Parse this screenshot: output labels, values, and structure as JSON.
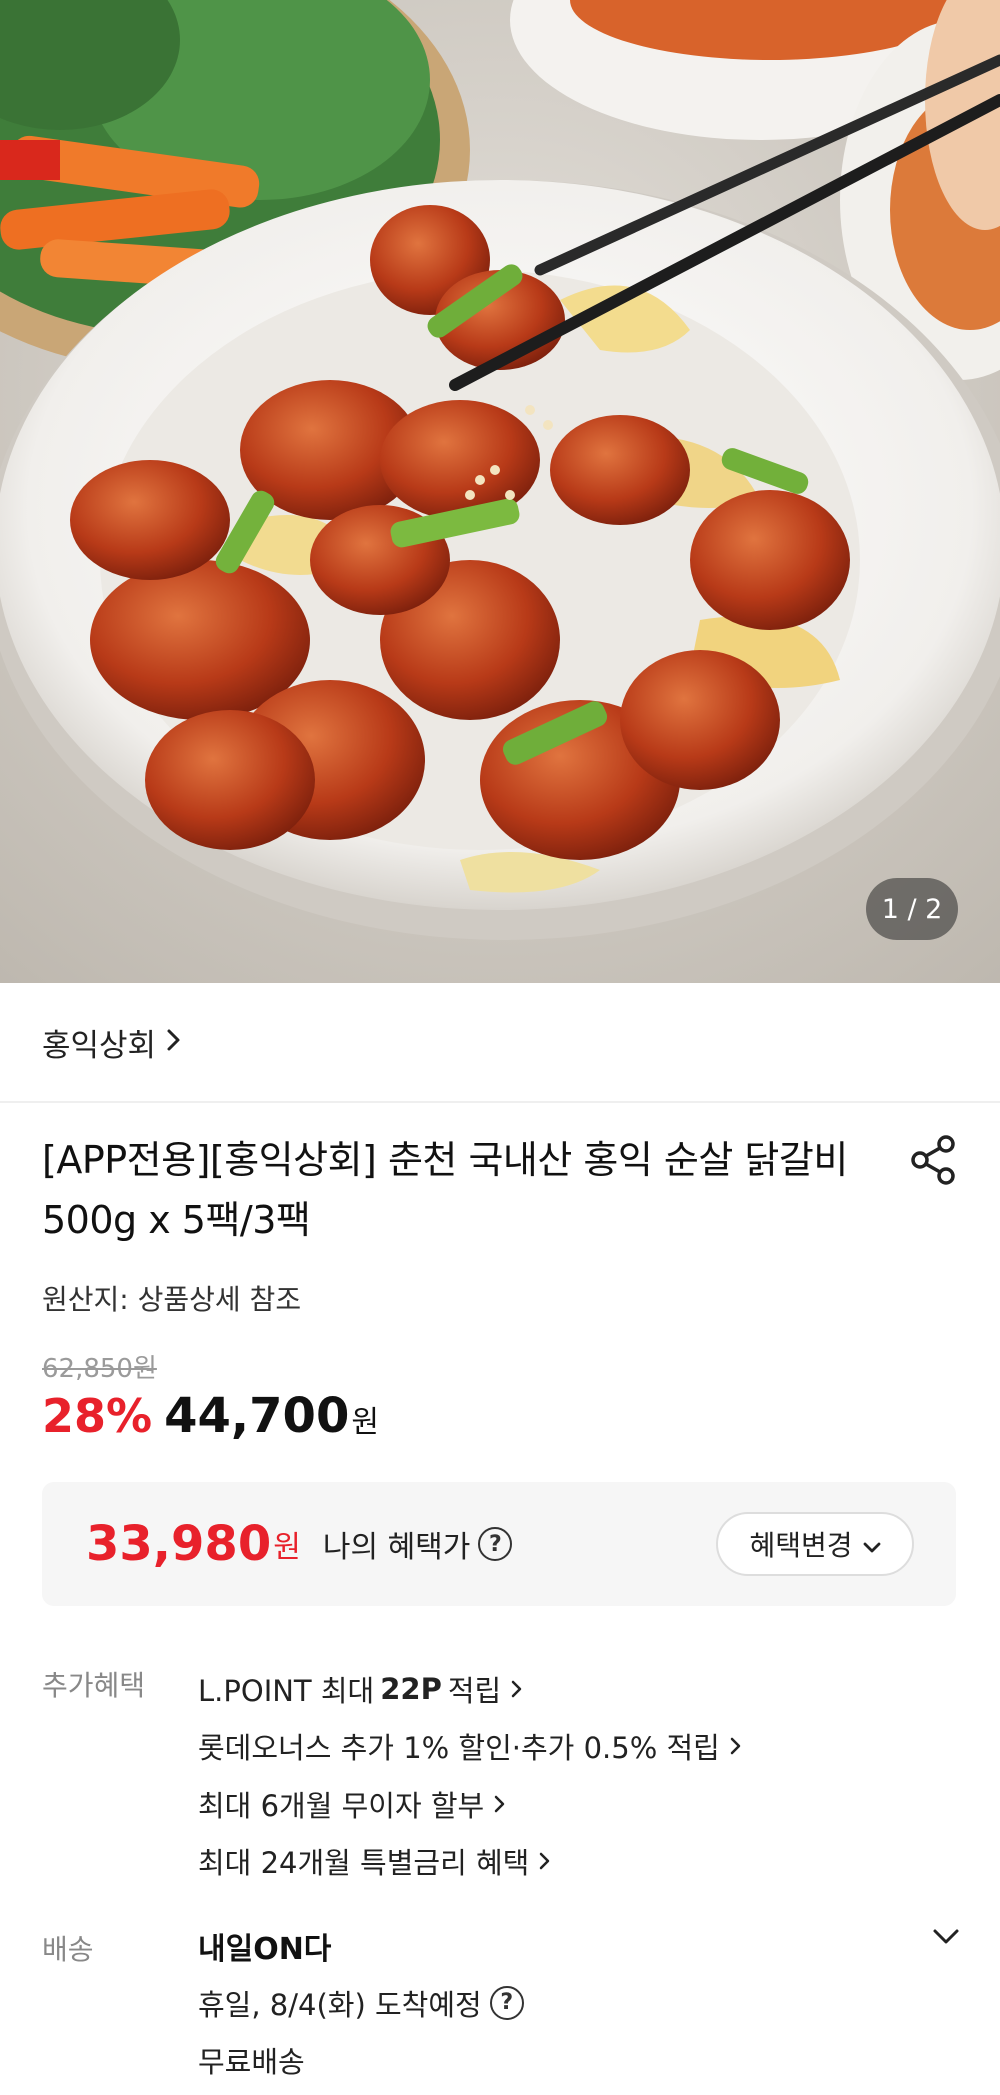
{
  "hero": {
    "counter": "1 / 2"
  },
  "store": {
    "name": "홍익상회"
  },
  "product": {
    "title": "[APP전용][홍익상회] 춘천 국내산 홍익 순살 닭갈비 500g x 5팩/3팩",
    "origin": "원산지: 상품상세 참조",
    "original_price": "62,850원",
    "discount": "28%",
    "price": "44,700",
    "price_unit": "원"
  },
  "benefit": {
    "price": "33,980",
    "unit": "원",
    "label": "나의 혜택가",
    "help": "?",
    "change_label": "혜택변경"
  },
  "extra": {
    "label": "추가혜택",
    "items": [
      {
        "pre": "L.POINT 최대",
        "bold": "22P",
        "post": "적립"
      },
      {
        "text": "롯데오너스 추가 1% 할인·추가 0.5% 적립"
      },
      {
        "text": "최대 6개월 무이자 할부"
      },
      {
        "text": "최대 24개월 특별금리 혜택"
      }
    ]
  },
  "delivery": {
    "label": "배송",
    "title": "내일ON다",
    "eta": "휴일, 8/4(화) 도착예정",
    "fee": "무료배송"
  },
  "colors": {
    "accent_red": "#e8212b",
    "muted_gray": "#888888"
  },
  "icons": [
    "share-icon",
    "chevron-right-icon",
    "chevron-down-icon",
    "help-circle-icon"
  ]
}
